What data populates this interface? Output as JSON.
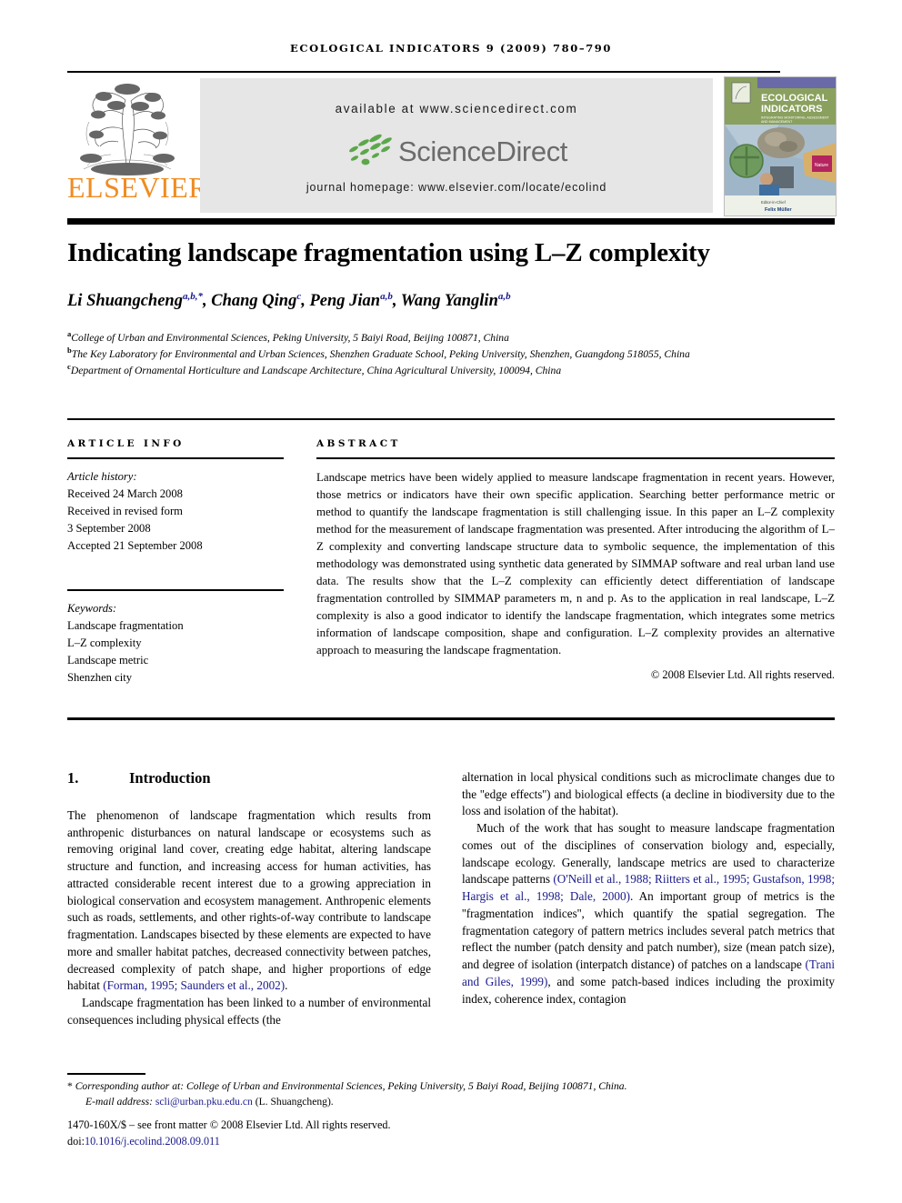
{
  "running_head": "Ecological Indicators 9 (2009) 780–790",
  "header": {
    "available_at": "available at www.sciencedirect.com",
    "sciencedirect_word": "ScienceDirect",
    "journal_homepage": "journal homepage: www.elsevier.com/locate/ecolind",
    "publisher": "ELSEVIER",
    "cover": {
      "line1": "ECOLOGICAL",
      "line2": "INDICATORS",
      "subtitle": "INTEGRATING MONITORING, ASSESSMENT AND MANAGEMENT",
      "editor_label": "Editor-in-Chief",
      "editor_name": "Felix Müller"
    },
    "colors": {
      "elsevier_orange": "#F08C22",
      "sciencedirect_green": "#5CA74A",
      "sciencedirect_gray": "#6b6b6b",
      "banner_bg": "#e6e6e6",
      "cover_green": "#7f9b5a",
      "cover_purple": "#6b6aa8"
    }
  },
  "article": {
    "title": "Indicating landscape fragmentation using L–Z complexity",
    "authors": [
      {
        "name": "Li Shuangcheng",
        "sup": "a,b,*"
      },
      {
        "name": "Chang Qing",
        "sup": "c"
      },
      {
        "name": "Peng Jian",
        "sup": "a,b"
      },
      {
        "name": "Wang Yanglin",
        "sup": "a,b"
      }
    ],
    "affiliations": [
      {
        "mark": "a",
        "text": "College of Urban and Environmental Sciences, Peking University, 5 Baiyi Road, Beijing 100871, China"
      },
      {
        "mark": "b",
        "text": "The Key Laboratory for Environmental and Urban Sciences, Shenzhen Graduate School, Peking University, Shenzhen, Guangdong 518055, China"
      },
      {
        "mark": "c",
        "text": "Department of Ornamental Horticulture and Landscape Architecture, China Agricultural University, 100094, China"
      }
    ]
  },
  "article_info": {
    "heading": "Article info",
    "history_label": "Article history:",
    "history": [
      "Received 24 March 2008",
      "Received in revised form",
      "3 September 2008",
      "Accepted 21 September 2008"
    ],
    "keywords_label": "Keywords:",
    "keywords": [
      "Landscape fragmentation",
      "L–Z complexity",
      "Landscape metric",
      "Shenzhen city"
    ]
  },
  "abstract": {
    "heading": "Abstract",
    "text": "Landscape metrics have been widely applied to measure landscape fragmentation in recent years. However, those metrics or indicators have their own specific application. Searching better performance metric or method to quantify the landscape fragmentation is still challenging issue. In this paper an L–Z complexity method for the measurement of landscape fragmentation was presented. After introducing the algorithm of L–Z complexity and converting landscape structure data to symbolic sequence, the implementation of this methodology was demonstrated using synthetic data generated by SIMMAP software and real urban land use data. The results show that the L–Z complexity can efficiently detect differentiation of landscape fragmentation controlled by SIMMAP parameters m, n and p. As to the application in real landscape, L–Z complexity is also a good indicator to identify the landscape fragmentation, which integrates some metrics information of landscape composition, shape and configuration. L–Z complexity provides an alternative approach to measuring the landscape fragmentation.",
    "copyright": "© 2008 Elsevier Ltd. All rights reserved."
  },
  "body": {
    "section_number": "1.",
    "section_title": "Introduction",
    "left_paragraphs": [
      "The phenomenon of landscape fragmentation which results from anthropenic disturbances on natural landscape or ecosystems such as removing original land cover, creating edge habitat, altering landscape structure and function, and increasing access for human activities, has attracted considerable recent interest due to a growing appreciation in biological conservation and ecosystem management. Anthropenic elements such as roads, settlements, and other rights-of-way contribute to landscape fragmentation. Landscapes bisected by these elements are expected to have more and smaller habitat patches, decreased connectivity between patches, decreased complexity of patch shape, and higher proportions of edge habitat ",
      "Landscape fragmentation has been linked to a number of environmental consequences including physical effects (the"
    ],
    "left_cite_1": "(Forman, 1995; Saunders et al., 2002)",
    "left_cite_1_tail": ".",
    "right_paragraphs": [
      "alternation in local physical conditions such as microclimate changes due to the ''edge effects'') and biological effects (a decline in biodiversity due to the loss and isolation of the habitat).",
      "Much of the work that has sought to measure landscape fragmentation comes out of the disciplines of conservation biology and, especially, landscape ecology. Generally, landscape metrics are used to characterize landscape patterns "
    ],
    "right_cite_1": "(O'Neill et al., 1988; Riitters et al., 1995; Gustafson, 1998; Hargis et al., 1998; Dale, 2000)",
    "right_tail_1": ". An important group of metrics is the ''fragmentation indices'', which quantify the spatial segregation. The fragmentation category of pattern metrics includes several patch metrics that reflect the number (patch density and patch number), size (mean patch size), and degree of isolation (interpatch distance) of patches on a landscape ",
    "right_cite_2": "(Trani and Giles, 1999)",
    "right_tail_2": ", and some patch-based indices including the proximity index, coherence index, contagion"
  },
  "footer": {
    "corresponding_marker": "*",
    "corresponding_label": "Corresponding author at:",
    "corresponding_text": " College of Urban and Environmental Sciences, Peking University, 5 Baiyi Road, Beijing 100871, China.",
    "email_label": "E-mail address:",
    "email": "scli@urban.pku.edu.cn",
    "email_owner": "(L. Shuangcheng).",
    "issn_line": "1470-160X/$ – see front matter © 2008 Elsevier Ltd. All rights reserved.",
    "doi_label": "doi:",
    "doi": "10.1016/j.ecolind.2008.09.011"
  }
}
